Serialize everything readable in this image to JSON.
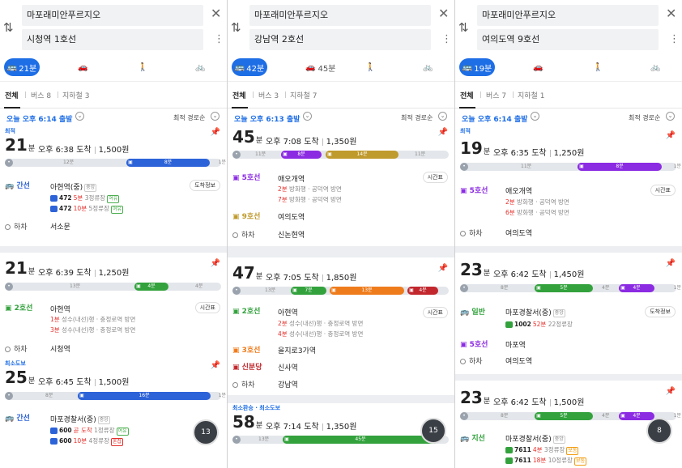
{
  "colors": {
    "accent": "#1e6ee6",
    "bus_blue": "#2d63d8",
    "line2": "#33a23d",
    "line5": "#8b2be2",
    "line9": "#bf9a2c",
    "line3": "#ef7c1c",
    "shinbundang": "#c1272d",
    "bus_green": "#33a23d",
    "walk": "#9aa3ad",
    "late": "#e5302c"
  },
  "panels": [
    {
      "origin": "마포래미안푸르지오",
      "destination": "시청역 1호선",
      "modes": {
        "transit": "21분",
        "car": "",
        "walk": "",
        "bike": ""
      },
      "tabs": {
        "all": "전체",
        "bus": "버스 8",
        "subway": "지하철 3"
      },
      "depart": "오늘 오후 6:14 출발",
      "sort": "최적 경로순",
      "routes": [
        {
          "badge": "최적",
          "minutes": "21",
          "unit": "분",
          "arrive": "오후 6:38 도착",
          "fare": "1,500원",
          "bar": {
            "walk1": "12분",
            "seg": "8분",
            "walk2": "1분"
          },
          "steps": [
            {
              "line": "간선",
              "stop": "아현역(중)",
              "tag": "중앙",
              "buses": [
                {
                  "no": "472",
                  "eta": "5분",
                  "rest": " 3정류장",
                  "tag": "여유"
                },
                {
                  "no": "472",
                  "eta": "10분",
                  "rest": " 5정류장",
                  "tag": "여유"
                }
              ],
              "btn": "도착정보"
            }
          ],
          "alight": "하차",
          "dest": "서소문"
        },
        {
          "badge": "",
          "minutes": "21",
          "unit": "분",
          "arrive": "오후 6:39 도착",
          "fare": "1,250원",
          "bar": {
            "walk1": "13분",
            "seg": "4분",
            "walk2": "4분"
          },
          "steps": [
            {
              "line": "2호선",
              "stop": "아현역",
              "subs": [
                {
                  "eta": "1분",
                  "rest": " 성수(내선)행 · 충정로역 방면"
                },
                {
                  "eta": "3분",
                  "rest": " 성수(내선)행 · 충정로역 방면"
                }
              ],
              "btn": "시간표"
            }
          ],
          "alight": "하차",
          "dest": "시청역"
        },
        {
          "badge": "최소도보",
          "minutes": "25",
          "unit": "분",
          "arrive": "오후 6:45 도착",
          "fare": "1,500원",
          "bar": {
            "walk1": "8분",
            "seg": "16분",
            "walk2": "1분"
          },
          "steps": [
            {
              "line": "간선",
              "stop": "마포경찰서(중)",
              "tag": "중앙",
              "buses": [
                {
                  "no": "600",
                  "eta": "곧 도착",
                  "rest": " 1정류장",
                  "tag": "여유"
                },
                {
                  "no": "600",
                  "eta": "10분",
                  "rest": " 4정류장",
                  "tag": "혼잡"
                }
              ]
            }
          ]
        }
      ],
      "fab": "13"
    },
    {
      "origin": "마포래미안푸르지오",
      "destination": "강남역 2호선",
      "modes": {
        "transit": "42분",
        "car": "45분",
        "walk": "",
        "bike": ""
      },
      "tabs": {
        "all": "전체",
        "bus": "버스 3",
        "subway": "지하철 7"
      },
      "depart": "오늘 오후 6:13 출발",
      "sort": "최적 경로순",
      "routes": [
        {
          "badge": "",
          "minutes": "45",
          "unit": "분",
          "arrive": "오후 7:08 도착",
          "fare": "1,350원",
          "bar": {
            "walk1": "11분",
            "seg1": "8분",
            "seg2": "14분",
            "walk2": "11분"
          },
          "steps": [
            {
              "line": "5호선",
              "stop": "애오개역",
              "subs": [
                {
                  "eta": "2분",
                  "rest": " 방화행 · 공덕역 방면"
                },
                {
                  "eta": "7분",
                  "rest": " 방화행 · 공덕역 방면"
                }
              ],
              "btn": "시간표"
            },
            {
              "line": "9호선",
              "stop": "여의도역"
            }
          ],
          "alight": "하차",
          "dest": "신논현역"
        },
        {
          "badge": "",
          "minutes": "47",
          "unit": "분",
          "arrive": "오후 7:05 도착",
          "fare": "1,850원",
          "bar": {
            "walk1": "13분",
            "seg1": "7분",
            "seg2": "13분",
            "seg3": "4분"
          },
          "steps": [
            {
              "line": "2호선",
              "stop": "아현역",
              "subs": [
                {
                  "eta": "2분",
                  "rest": " 성수(내선)행 · 충정로역 방면"
                },
                {
                  "eta": "4분",
                  "rest": " 성수(내선)행 · 충정로역 방면"
                }
              ],
              "btn": "시간표"
            },
            {
              "line": "3호선",
              "stop": "을지로3가역"
            },
            {
              "line": "신분당",
              "stop": "신사역"
            }
          ],
          "alight": "하차",
          "dest": "강남역"
        },
        {
          "badge": "최소환승 · 최소도보",
          "minutes": "58",
          "unit": "분",
          "arrive": "오후 7:14 도착",
          "fare": "1,350원",
          "bar": {
            "walk1": "13분",
            "seg": "45분"
          }
        }
      ],
      "fab": "15"
    },
    {
      "origin": "마포래미안푸르지오",
      "destination": "여의도역 9호선",
      "modes": {
        "transit": "19분",
        "car": "",
        "walk": "",
        "bike": ""
      },
      "tabs": {
        "all": "전체",
        "bus": "버스 7",
        "subway": "지하철 1"
      },
      "depart": "오늘 오후 6:14 출발",
      "sort": "최적 경로순",
      "routes": [
        {
          "badge": "최적",
          "minutes": "19",
          "unit": "분",
          "arrive": "오후 6:35 도착",
          "fare": "1,250원",
          "bar": {
            "walk1": "11분",
            "seg": "8분",
            "walk2": "1분"
          },
          "steps": [
            {
              "line": "5호선",
              "stop": "애오개역",
              "subs": [
                {
                  "eta": "2분",
                  "rest": " 방화행 · 공덕역 방면"
                },
                {
                  "eta": "6분",
                  "rest": " 방화행 · 공덕역 방면"
                }
              ],
              "btn": "시간표"
            }
          ],
          "alight": "하차",
          "dest": "여의도역"
        },
        {
          "badge": "",
          "minutes": "23",
          "unit": "분",
          "arrive": "오후 6:42 도착",
          "fare": "1,450원",
          "bar": {
            "walk1": "8분",
            "seg1": "5분",
            "mid": "4분",
            "seg2": "4분",
            "walk2": "1분"
          },
          "steps": [
            {
              "line": "일반",
              "stop": "마포경찰서(중)",
              "tag": "중앙",
              "buses": [
                {
                  "no": "1002",
                  "eta": "52분",
                  "rest": " 22정류장",
                  "tag": ""
                }
              ],
              "btn": "도착정보"
            },
            {
              "line": "5호선",
              "stop": "마포역"
            }
          ],
          "alight": "하차",
          "dest": "여의도역"
        },
        {
          "badge": "",
          "minutes": "23",
          "unit": "분",
          "arrive": "오후 6:42 도착",
          "fare": "1,500원",
          "bar": {
            "walk1": "8분",
            "seg1": "5분",
            "mid": "4분",
            "seg2": "4분",
            "walk2": "1분"
          },
          "steps": [
            {
              "line": "지선",
              "stop": "마포경찰서(중)",
              "tag": "중앙",
              "buses": [
                {
                  "no": "7611",
                  "eta": "4분",
                  "rest": " 3정류장",
                  "tag": "보통"
                },
                {
                  "no": "7611",
                  "eta": "18분",
                  "rest": " 10정류장",
                  "tag": "보통"
                }
              ]
            }
          ]
        }
      ],
      "fab": "8"
    }
  ]
}
